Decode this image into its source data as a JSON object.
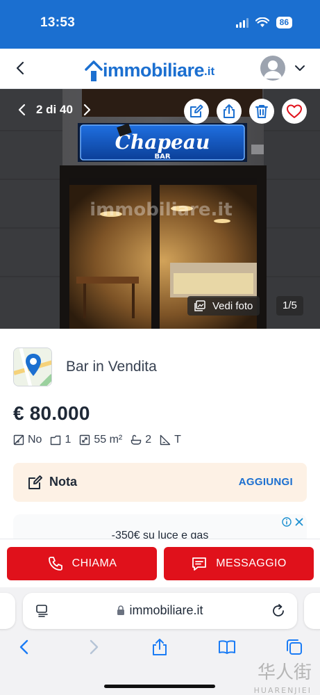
{
  "status_bar": {
    "time": "13:53",
    "battery": "86"
  },
  "header": {
    "logo_text": "immobiliare",
    "logo_suffix": ".it"
  },
  "gallery": {
    "position": "2 di 40",
    "photo_watermark": "immobiliare.it",
    "sign_name": "Chapeau",
    "sign_sub": "BAR",
    "view_photos_label": "Vedi foto",
    "photo_counter": "1/5",
    "actions": [
      "edit-icon",
      "share-icon",
      "trash-icon",
      "heart-icon"
    ]
  },
  "listing": {
    "title": "Bar in Vendita",
    "price": "€ 80.000",
    "features": [
      {
        "icon": "no-furniture-icon",
        "value": "No"
      },
      {
        "icon": "rooms-icon",
        "value": "1"
      },
      {
        "icon": "area-icon",
        "value": "55 m²"
      },
      {
        "icon": "bathtub-icon",
        "value": "2"
      },
      {
        "icon": "floor-icon",
        "value": "T"
      }
    ]
  },
  "note": {
    "label": "Nota",
    "action": "AGGIUNGI"
  },
  "ad": {
    "text": "-350€ su luce e gas"
  },
  "actions": {
    "call_label": "CHIAMA",
    "message_label": "MESSAGGIO"
  },
  "browser": {
    "url": "immobiliare.it"
  },
  "watermark": {
    "text": "华人街",
    "sub": "HUARENJIEI"
  },
  "colors": {
    "brand_blue": "#1b6fd0",
    "cta_red": "#e0111b",
    "note_bg": "#fdf1e5"
  }
}
